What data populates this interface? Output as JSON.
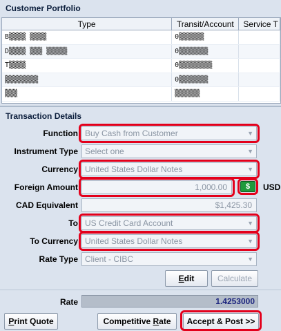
{
  "portfolio": {
    "title": "Customer Portfolio",
    "columns": [
      "Type",
      "Transit/Account",
      "Service T"
    ],
    "rows": [
      [
        "B▒▒▒▒ ▒▒▒▒",
        "0▒▒▒▒▒▒",
        ""
      ],
      [
        "D▒▒▒▒ ▒▒▒ ▒▒▒▒▒",
        "0▒▒▒▒▒▒▒",
        ""
      ],
      [
        "T▒▒▒▒",
        "0▒▒▒▒▒▒▒▒",
        ""
      ],
      [
        "▒▒▒▒▒▒▒▒",
        "0▒▒▒▒▒▒▒",
        ""
      ],
      [
        "▒▒▒",
        "▒▒▒▒▒▒",
        ""
      ]
    ]
  },
  "transaction": {
    "title": "Transaction Details",
    "function_label": "Function",
    "function_value": "Buy Cash from Customer",
    "instrument_label": "Instrument Type",
    "instrument_value": "Select one",
    "currency_label": "Currency",
    "currency_value": "United States Dollar Notes",
    "foreign_amount_label": "Foreign Amount",
    "foreign_amount_value": "1,000.00",
    "foreign_currency_code": "USD",
    "money_icon": "money-note-icon",
    "cad_label": "CAD Equivalent",
    "cad_value": "$1,425.30",
    "to_label": "To",
    "to_value": "US Credit Card Account",
    "to_currency_label": "To Currency",
    "to_currency_value": "United States Dollar Notes",
    "rate_type_label": "Rate Type",
    "rate_type_value": "Client - CIBC",
    "edit_label_u": "E",
    "edit_label_rest": "dit",
    "calculate_label": "Calculate",
    "rate_label": "Rate",
    "rate_value": "1.4253000"
  },
  "actions": {
    "print_u": "P",
    "print_rest": "rint Quote",
    "competitive_pre": "Competitive ",
    "competitive_u": "R",
    "competitive_rest": "ate",
    "accept_pre": "Accept & Post >>"
  },
  "colors": {
    "highlight": "#e3001b",
    "background": "#dbe3ee"
  }
}
